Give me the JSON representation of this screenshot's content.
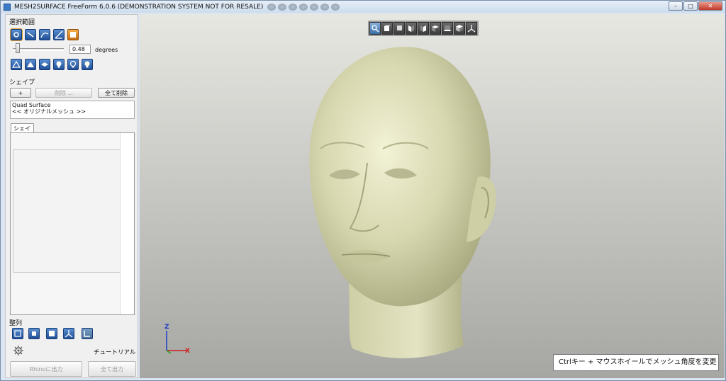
{
  "window": {
    "title": "MESH2SURFACE FreeForm 6.0.6 (DEMONSTRATION SYSTEM NOT FOR RESALE)"
  },
  "left": {
    "selection_label": "選択範囲",
    "angle_value": "0.48",
    "angle_unit": "degrees",
    "shape_label": "シェイプ",
    "add_label": "+",
    "delete_label": "削除 ...",
    "delete_all_label": "全て削除",
    "info_line1": "Quad Surface",
    "info_line2": "<< オリジナルメッシュ >>",
    "tab_label": "シェイプ",
    "align_label": "整列",
    "tutorial_label": "チュートリアル",
    "rhino_label": "Rhinoに出力",
    "export_all_label": "全て出力"
  },
  "viewport": {
    "hint": "Ctrlキー + マウスホイールでメッシュ角度を変更",
    "axis_z": "Z",
    "axis_x": "X"
  },
  "colors": {
    "accent": "#1f4f98",
    "model": "#dcdcb4"
  }
}
